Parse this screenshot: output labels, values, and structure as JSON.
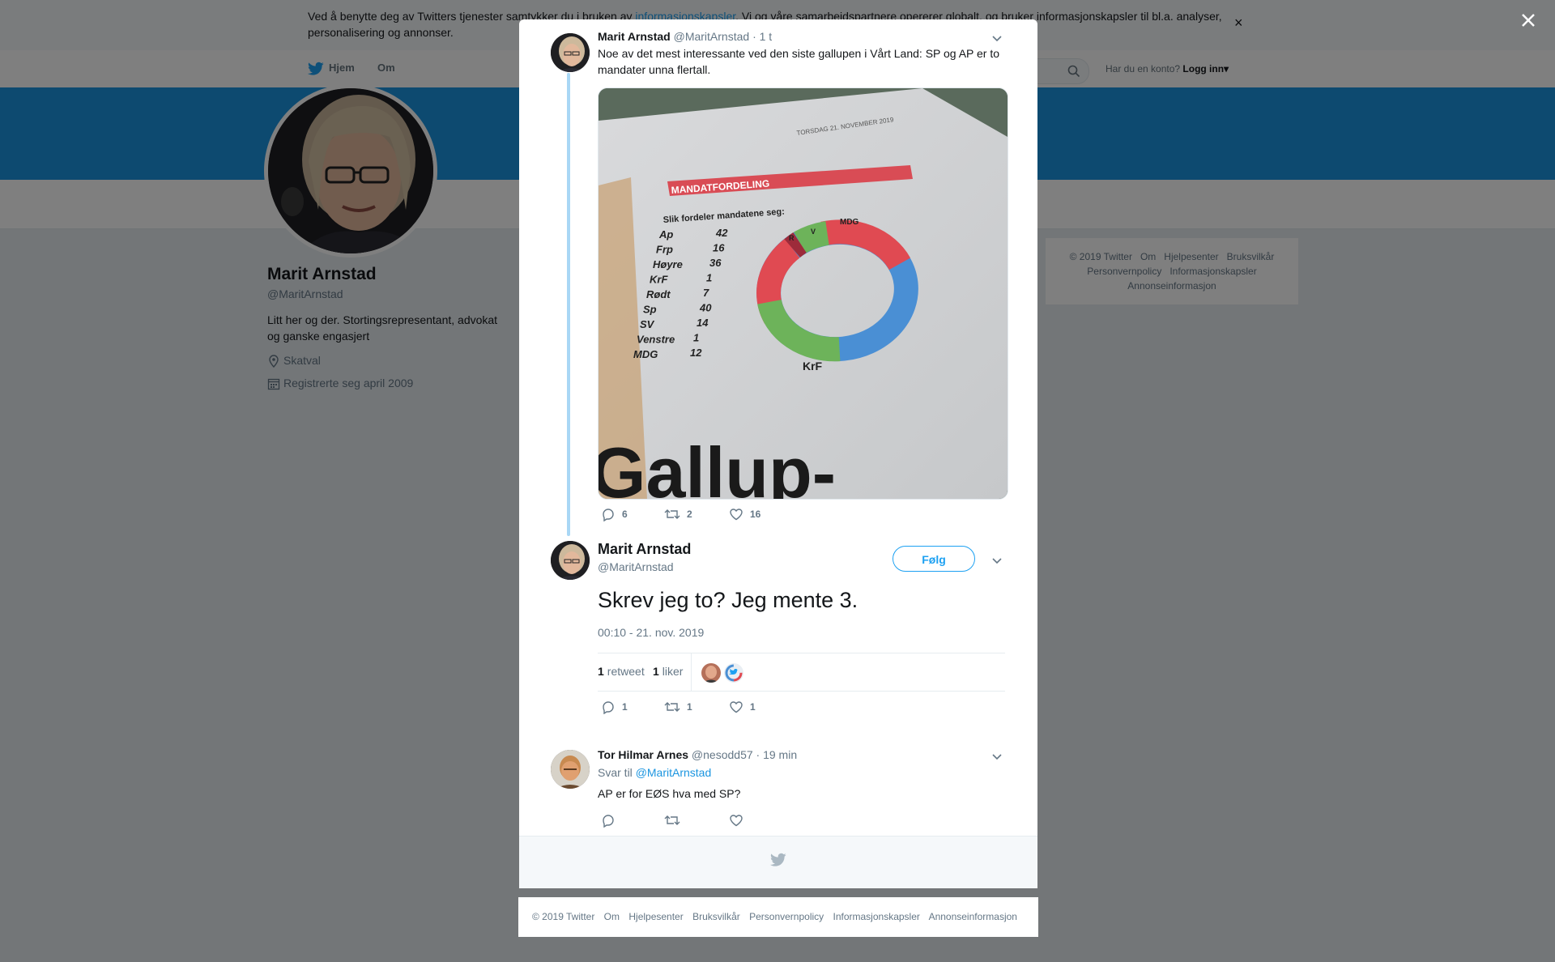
{
  "cookie_banner": {
    "text_before": "Ved å benytte deg av Twitters tjenester samtykker du i bruken av ",
    "link": "informasjonskapsler",
    "text_after": ". Vi og våre samarbeidspartnere opererer globalt, og bruker informasjonskapsler til bl.a. analyser, personalisering og annonser.",
    "close": "×"
  },
  "nav": {
    "home": "Hjem",
    "about": "Om",
    "account_prompt": "Har du en konto?",
    "login": "Logg inn▾"
  },
  "profile": {
    "name": "Marit Arnstad",
    "handle": "@MaritArnstad",
    "bio": "Litt her og der. Stortingsrepresentant, advokat og ganske engasjert",
    "location": "Skatval",
    "joined": "Registrerte seg april 2009"
  },
  "side_footer": {
    "row1": [
      "© 2019 Twitter",
      "Om",
      "Hjelpesenter",
      "Bruksvilkår"
    ],
    "row2": [
      "Personvernpolicy",
      "Informasjonskapsler"
    ],
    "row3": [
      "Annonseinformasjon"
    ]
  },
  "thread": {
    "parent": {
      "name": "Marit Arnstad",
      "handle": "@MaritArnstad",
      "time": "· 1 t",
      "text": "Noe av det mest interessante ved den siste gallupen i Vårt Land: SP og AP er to mandater unna flertall.",
      "replies": "6",
      "retweets": "2",
      "likes": "16",
      "image": {
        "date": "TORSDAG 21. NOVEMBER 2019",
        "heading": "MANDATFORDELING",
        "subheading": "Slik fordeler mandatene seg:",
        "parties": [
          {
            "party": "Ap",
            "seats": "42"
          },
          {
            "party": "Frp",
            "seats": "16"
          },
          {
            "party": "Høyre",
            "seats": "36"
          },
          {
            "party": "KrF",
            "seats": "1"
          },
          {
            "party": "Rødt",
            "seats": "7"
          },
          {
            "party": "Sp",
            "seats": "40"
          },
          {
            "party": "SV",
            "seats": "14"
          },
          {
            "party": "Venstre",
            "seats": "1"
          },
          {
            "party": "MDG",
            "seats": "12"
          }
        ],
        "donut_labels": [
          "R",
          "V",
          "MDG",
          "KrF"
        ],
        "big_text": "Gallup-"
      }
    },
    "main": {
      "name": "Marit Arnstad",
      "handle": "@MaritArnstad",
      "follow": "Følg",
      "text": "Skrev jeg to? Jeg mente 3.",
      "timestamp": "00:10 - 21. nov. 2019",
      "retweet_count": "1",
      "retweet_label": "retweet",
      "like_count": "1",
      "like_label": "liker",
      "replies": "1",
      "retweets": "1",
      "likes": "1"
    },
    "reply": {
      "name": "Tor Hilmar Arnes",
      "handle": "@nesodd57",
      "time": "· 19 min",
      "reply_prefix": "Svar til",
      "reply_target": "@MaritArnstad",
      "text": "AP er for EØS hva med SP?"
    }
  },
  "bottom_footer": [
    "© 2019 Twitter",
    "Om",
    "Hjelpesenter",
    "Bruksvilkår",
    "Personvernpolicy",
    "Informasjonskapsler",
    "Annonseinformasjon"
  ],
  "colors": {
    "brand": "#1da1f2",
    "banner": "#1b95e0",
    "overlay": "rgba(0,0,0,0.5)",
    "thread_line": "#a9d7f5"
  },
  "icons": [
    "close-icon",
    "twitter-bird-icon",
    "search-icon",
    "location-icon",
    "calendar-icon",
    "chevron-down-icon",
    "reply-icon",
    "retweet-icon",
    "like-icon"
  ]
}
